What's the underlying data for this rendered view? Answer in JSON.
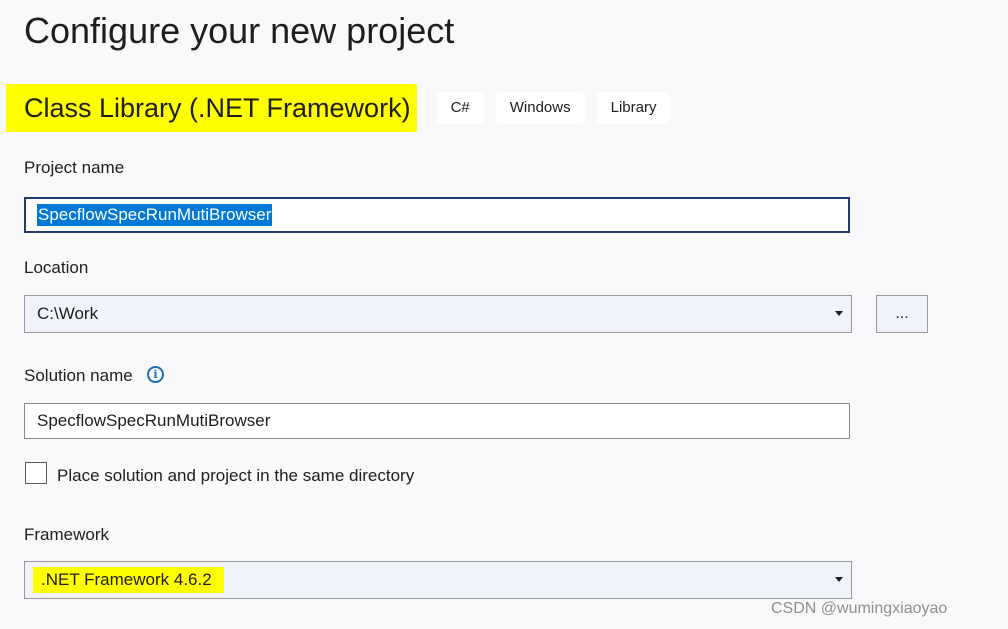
{
  "page": {
    "title": "Configure your new project"
  },
  "template": {
    "name": "Class Library (.NET Framework)",
    "tags": [
      "C#",
      "Windows",
      "Library"
    ]
  },
  "project_name": {
    "label": "Project name",
    "value": "SpecflowSpecRunMutiBrowser"
  },
  "location": {
    "label": "Location",
    "value": "C:\\Work",
    "browse_label": "..."
  },
  "solution_name": {
    "label": "Solution name",
    "value": "SpecflowSpecRunMutiBrowser",
    "info_icon": "info-icon"
  },
  "same_directory": {
    "label": "Place solution and project in the same directory",
    "checked": false
  },
  "framework": {
    "label": "Framework",
    "value": ".NET Framework 4.6.2"
  },
  "watermark": "CSDN @wumingxiaoyao",
  "colors": {
    "highlight": "#ffff00",
    "selection": "#0078d7",
    "focus_border": "#1f3c6b",
    "info_icon": "#1d6fb8"
  }
}
